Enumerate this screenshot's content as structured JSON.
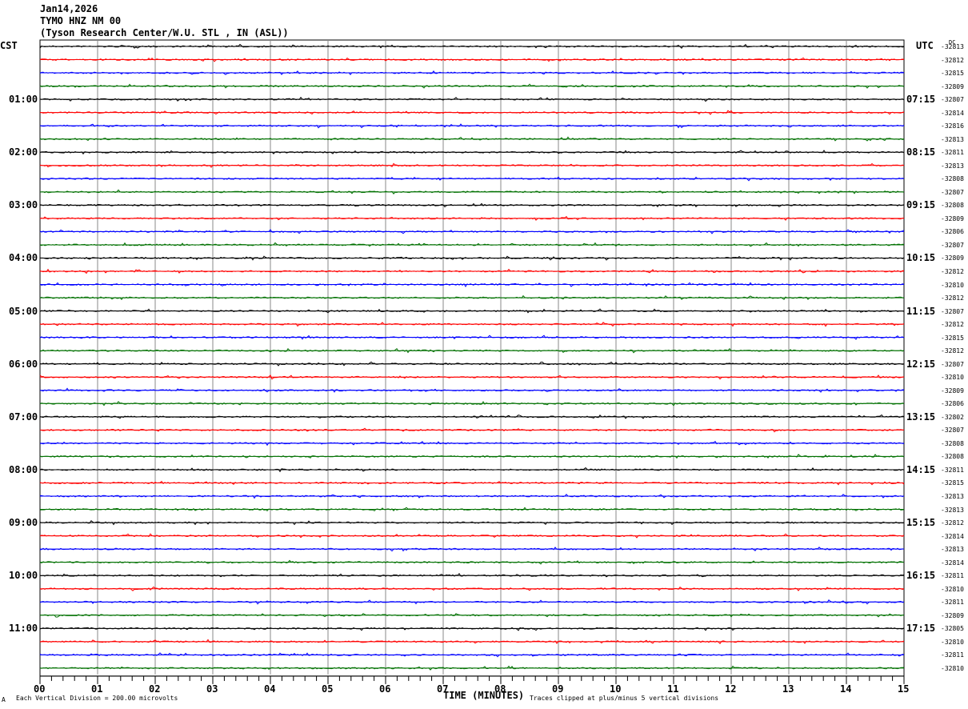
{
  "header": {
    "date": "Jan14,2026",
    "station": "TYMO HNZ NM 00",
    "site": "(Tyson Research Center/W.U. STL , IN (ASL))"
  },
  "left_tz": "CST",
  "right_tz": "UTC",
  "dc_label": "DC",
  "footer": {
    "scale": "Each Vertical Division =  200.00 microvolts",
    "xlabel": "TIME (MINUTES)",
    "clip": "Traces clipped at plus/minus 5 vertical divisions",
    "logo": "A"
  },
  "chart_data": {
    "type": "line",
    "title": "TYMO HNZ NM 00 helicorder",
    "xlabel": "TIME (MINUTES)",
    "xlim": [
      0,
      15
    ],
    "x_ticks": [
      "00",
      "01",
      "02",
      "03",
      "04",
      "05",
      "06",
      "07",
      "08",
      "09",
      "10",
      "11",
      "12",
      "13",
      "14",
      "15"
    ],
    "rows_per_hour": 4,
    "row_minutes": 15,
    "trace_colors": [
      "#000000",
      "#ff0000",
      "#0000ff",
      "#007000"
    ],
    "cst_labels": [
      "01:00",
      "02:00",
      "03:00",
      "04:00",
      "05:00",
      "06:00",
      "07:00",
      "08:00",
      "09:00",
      "10:00",
      "11:00"
    ],
    "utc_labels": [
      "07:15",
      "08:15",
      "09:15",
      "10:15",
      "11:15",
      "12:15",
      "13:15",
      "14:15",
      "15:15",
      "16:15",
      "17:15"
    ],
    "dc_offsets": [
      -32813,
      -32812,
      -32815,
      -32809,
      -32807,
      -32814,
      -32816,
      -32813,
      -32811,
      -32813,
      -32808,
      -32807,
      -32808,
      -32809,
      -32806,
      -32807,
      -32809,
      -32812,
      -32810,
      -32812,
      -32807,
      -32812,
      -32815,
      -32812,
      -32807,
      -32810,
      -32809,
      -32806,
      -32802,
      -32807,
      -32808,
      -32808,
      -32811,
      -32815,
      -32813,
      -32813,
      -32812,
      -32814,
      -32813,
      -32814,
      -32811,
      -32810,
      -32811,
      -32809,
      -32805,
      -32810,
      -32811,
      -32810
    ]
  }
}
